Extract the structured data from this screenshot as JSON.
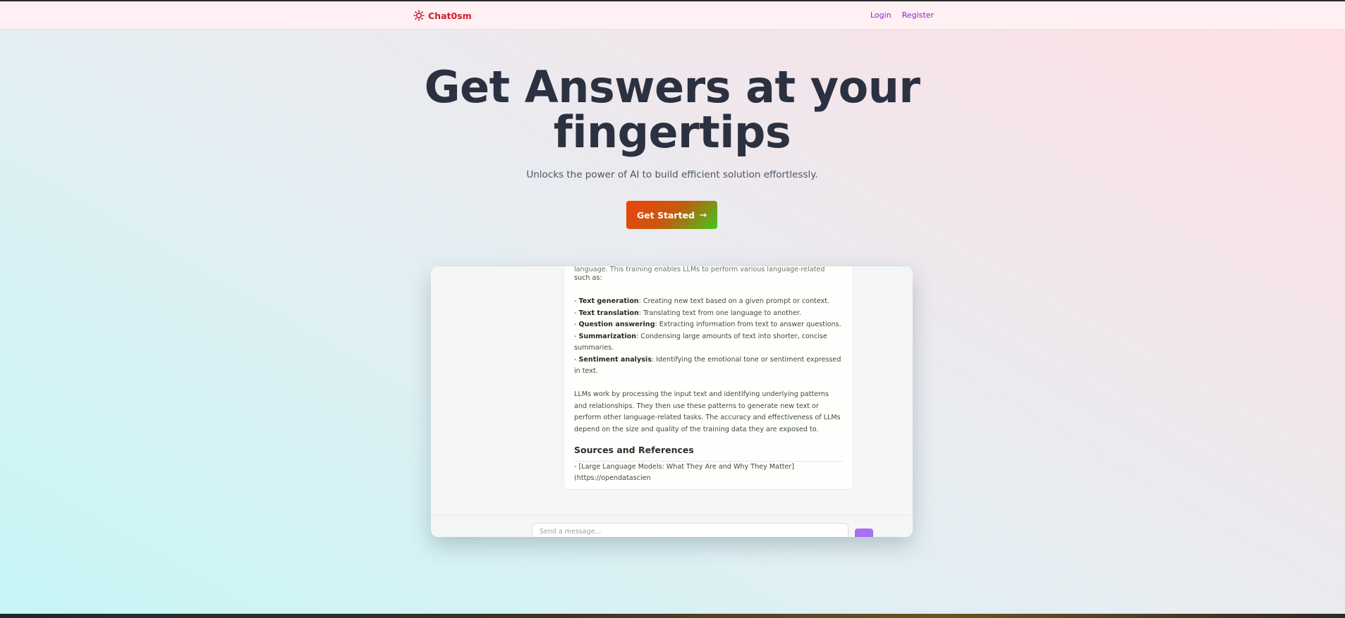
{
  "nav": {
    "brand": "Chat0sm",
    "brand_icon": "sparkle-logo-icon",
    "login": "Login",
    "register": "Register",
    "link_color": "#8b1fd1",
    "brand_color": "#d11a2a"
  },
  "hero": {
    "title_line1": "Get Answers at your",
    "title_line2": "fingertips",
    "subtitle": "Unlocks the power of AI to build efficient solution effortlessly.",
    "cta_label": "Get Started",
    "cta_icon": "arrow-right-icon"
  },
  "preview": {
    "clipped_line": "language. This training enables LLMs to perform various language-related tasks,",
    "intro_end": "such as:",
    "bullets": [
      {
        "term": "Text generation",
        "desc": ": Creating new text based on a given prompt or context."
      },
      {
        "term": "Text translation",
        "desc": ": Translating text from one language to another."
      },
      {
        "term": "Question answering",
        "desc": ": Extracting information from text to answer questions."
      },
      {
        "term": "Summarization",
        "desc": ": Condensing large amounts of text into shorter, concise summaries."
      },
      {
        "term": "Sentiment analysis",
        "desc": ": Identifying the emotional tone or sentiment expressed in text."
      }
    ],
    "paragraph": "LLMs work by processing the input text and identifying underlying patterns and relationships. They then use these patterns to generate new text or perform other language-related tasks. The accuracy and effectiveness of LLMs depend on the size and quality of the training data they are exposed to.",
    "sources_heading": "Sources and References",
    "source_line1": "- [Large Language Models: What They Are and Why They Matter]",
    "source_line2": "(https://opendatascien",
    "input_placeholder": "Send a message...",
    "send_icon": "send-icon"
  }
}
